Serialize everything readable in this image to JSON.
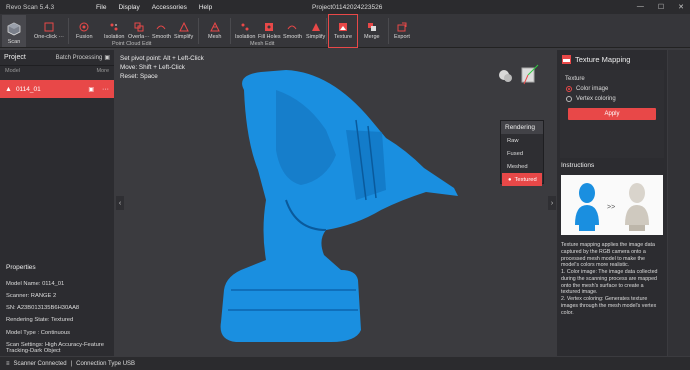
{
  "app": {
    "name": "Revo Scan 5.4.3",
    "document": "Project01142024223526"
  },
  "menu": [
    "File",
    "Display",
    "Accessories",
    "Help"
  ],
  "toolbar": {
    "scan": "Scan",
    "one_click": "One-click ···",
    "fusion": "Fusion",
    "isolation": "Isolation",
    "overlap": "Overla···",
    "smooth": "Smooth",
    "simplify": "Simplify",
    "point_cloud_edit": "Point Cloud Edit",
    "mesh": "Mesh",
    "mesh_isolation": "Isolation",
    "fill_holes": "Fill Holes",
    "mesh_smooth": "Smooth",
    "mesh_simplify": "Simplify",
    "mesh_edit": "Mesh Edit",
    "texture": "Texture",
    "merge": "Merge",
    "export": "Export"
  },
  "project": {
    "title": "Project",
    "batch": "Batch Processing",
    "col_model": "Model",
    "col_more": "More",
    "model_name": "0114_01"
  },
  "properties": {
    "title": "Properties",
    "rows": [
      "Model Name:  0114_01",
      "Scanner:  RANGE 2",
      "SN:  A23B013135B6H30AA8",
      "Rendering State:  Textured",
      "Model Type :  Continuous",
      "Scan Settings:  High Accuracy-Feature Tracking-Dark Object"
    ]
  },
  "hints": [
    "Set pivot point: Alt + Left-Click",
    "Move: Shift + Left-Click",
    "Reset: Space"
  ],
  "rendering": {
    "title": "Rendering",
    "options": [
      "Raw",
      "Fused",
      "Meshed",
      "Textured"
    ],
    "selected": "Textured"
  },
  "texture": {
    "title": "Texture Mapping",
    "section": "Texture",
    "color_image": "Color image",
    "vertex_coloring": "Vertex coloring",
    "apply": "Apply",
    "instructions": "Instructions",
    "arrow": ">>",
    "text": "Texture mapping applies the image data captured by the RGB camera onto a processed mesh model to make the model's colors more realistic.\n1. Color image: The image data collected during the scanning process are mapped onto the mesh's surface to create a textured image.\n2. Vertex coloring: Generates texture images through the mesh model's vertex color."
  },
  "status": {
    "connected": "Scanner Connected",
    "sep": "|",
    "connection": "Connection Type USB"
  },
  "colors": {
    "accent": "#e84848",
    "model": "#1a8fe0"
  }
}
